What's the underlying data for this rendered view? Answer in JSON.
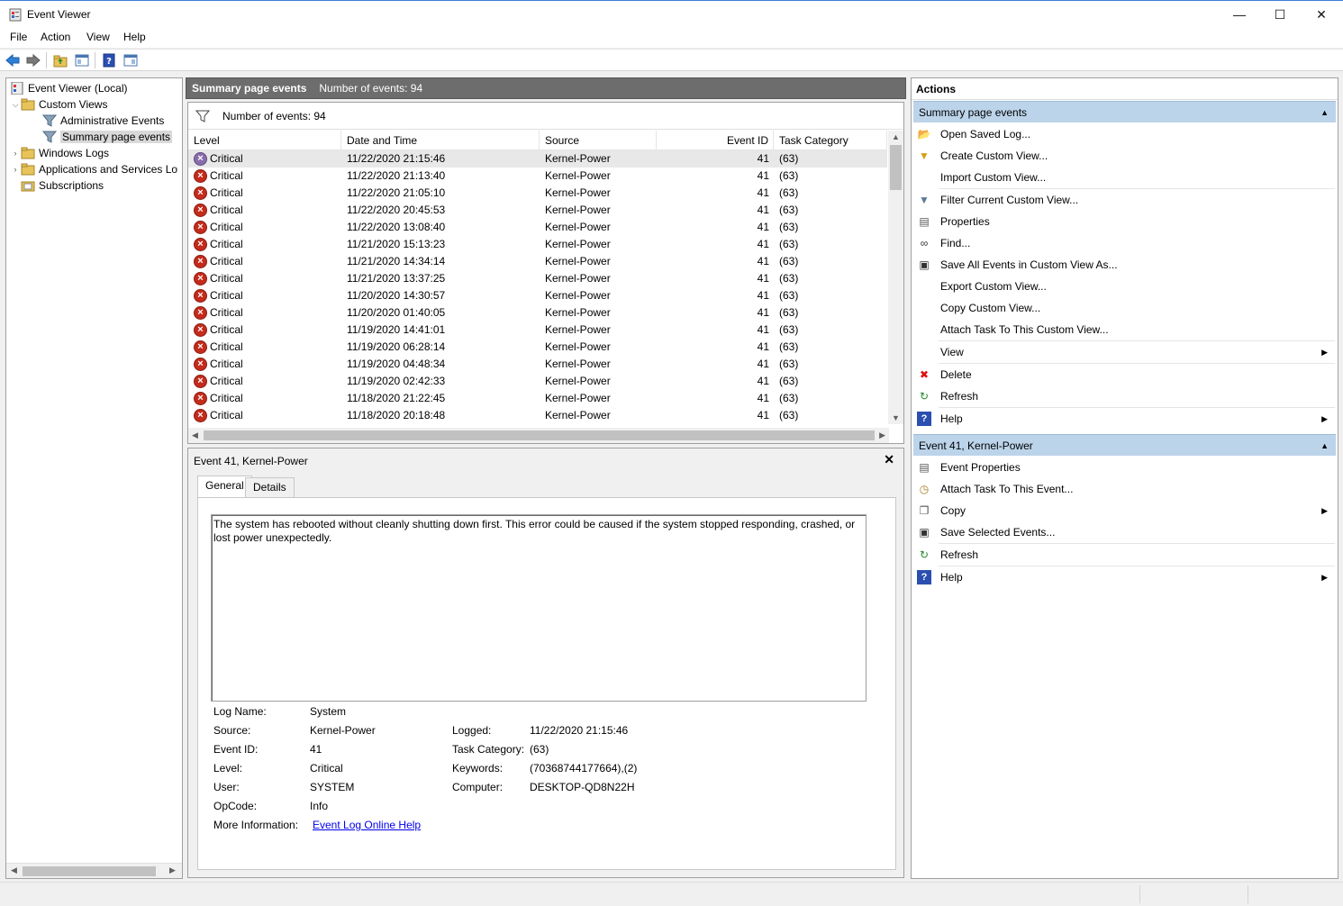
{
  "window": {
    "title": "Event Viewer",
    "minimize": "—",
    "maximize": "☐",
    "close": "✕"
  },
  "menu": [
    "File",
    "Action",
    "View",
    "Help"
  ],
  "tree": {
    "root": "Event Viewer (Local)",
    "custom_views": "Custom Views",
    "admin_events": "Administrative Events",
    "summary_events": "Summary page events",
    "windows_logs": "Windows Logs",
    "apps_services": "Applications and Services Lo",
    "subscriptions": "Subscriptions"
  },
  "center": {
    "header_title": "Summary page events",
    "header_count": "Number of events: 94",
    "filter_count": "Number of events: 94",
    "columns": [
      "Level",
      "Date and Time",
      "Source",
      "Event ID",
      "Task Category"
    ],
    "rows": [
      {
        "level": "Critical",
        "datetime": "11/22/2020 21:15:46",
        "source": "Kernel-Power",
        "id": "41",
        "task": "(63)"
      },
      {
        "level": "Critical",
        "datetime": "11/22/2020 21:13:40",
        "source": "Kernel-Power",
        "id": "41",
        "task": "(63)"
      },
      {
        "level": "Critical",
        "datetime": "11/22/2020 21:05:10",
        "source": "Kernel-Power",
        "id": "41",
        "task": "(63)"
      },
      {
        "level": "Critical",
        "datetime": "11/22/2020 20:45:53",
        "source": "Kernel-Power",
        "id": "41",
        "task": "(63)"
      },
      {
        "level": "Critical",
        "datetime": "11/22/2020 13:08:40",
        "source": "Kernel-Power",
        "id": "41",
        "task": "(63)"
      },
      {
        "level": "Critical",
        "datetime": "11/21/2020 15:13:23",
        "source": "Kernel-Power",
        "id": "41",
        "task": "(63)"
      },
      {
        "level": "Critical",
        "datetime": "11/21/2020 14:34:14",
        "source": "Kernel-Power",
        "id": "41",
        "task": "(63)"
      },
      {
        "level": "Critical",
        "datetime": "11/21/2020 13:37:25",
        "source": "Kernel-Power",
        "id": "41",
        "task": "(63)"
      },
      {
        "level": "Critical",
        "datetime": "11/20/2020 14:30:57",
        "source": "Kernel-Power",
        "id": "41",
        "task": "(63)"
      },
      {
        "level": "Critical",
        "datetime": "11/20/2020 01:40:05",
        "source": "Kernel-Power",
        "id": "41",
        "task": "(63)"
      },
      {
        "level": "Critical",
        "datetime": "11/19/2020 14:41:01",
        "source": "Kernel-Power",
        "id": "41",
        "task": "(63)"
      },
      {
        "level": "Critical",
        "datetime": "11/19/2020 06:28:14",
        "source": "Kernel-Power",
        "id": "41",
        "task": "(63)"
      },
      {
        "level": "Critical",
        "datetime": "11/19/2020 04:48:34",
        "source": "Kernel-Power",
        "id": "41",
        "task": "(63)"
      },
      {
        "level": "Critical",
        "datetime": "11/19/2020 02:42:33",
        "source": "Kernel-Power",
        "id": "41",
        "task": "(63)"
      },
      {
        "level": "Critical",
        "datetime": "11/18/2020 21:22:45",
        "source": "Kernel-Power",
        "id": "41",
        "task": "(63)"
      },
      {
        "level": "Critical",
        "datetime": "11/18/2020 20:18:48",
        "source": "Kernel-Power",
        "id": "41",
        "task": "(63)"
      }
    ]
  },
  "detail": {
    "title": "Event 41, Kernel-Power",
    "tabs": [
      "General",
      "Details"
    ],
    "description": "The system has rebooted without cleanly shutting down first. This error could be caused if the system stopped responding, crashed, or lost power unexpectedly.",
    "labels": {
      "log_name": "Log Name:",
      "source": "Source:",
      "event_id": "Event ID:",
      "level": "Level:",
      "user": "User:",
      "opcode": "OpCode:",
      "more_info": "More Information:",
      "logged": "Logged:",
      "task_category": "Task Category:",
      "keywords": "Keywords:",
      "computer": "Computer:"
    },
    "values": {
      "log_name": "System",
      "source": "Kernel-Power",
      "event_id": "41",
      "level": "Critical",
      "user": "SYSTEM",
      "opcode": "Info",
      "more_info": "Event Log Online Help",
      "logged": "11/22/2020 21:15:46",
      "task_category": "(63)",
      "keywords": "(70368744177664),(2)",
      "computer": "DESKTOP-QD8N22H"
    }
  },
  "actions": {
    "title": "Actions",
    "section1": "Summary page events",
    "items1": [
      {
        "label": "Open Saved Log...",
        "icon": "folder-open-icon"
      },
      {
        "label": "Create Custom View...",
        "icon": "filter-create-icon"
      },
      {
        "label": "Import Custom View...",
        "icon": "none"
      },
      {
        "label": "Filter Current Custom View...",
        "icon": "filter-icon"
      },
      {
        "label": "Properties",
        "icon": "properties-icon"
      },
      {
        "label": "Find...",
        "icon": "binoculars-icon"
      },
      {
        "label": "Save All Events in Custom View As...",
        "icon": "save-icon"
      },
      {
        "label": "Export Custom View...",
        "icon": "none"
      },
      {
        "label": "Copy Custom View...",
        "icon": "none"
      },
      {
        "label": "Attach Task To This Custom View...",
        "icon": "none"
      },
      {
        "label": "View",
        "icon": "none"
      },
      {
        "label": "Delete",
        "icon": "delete-icon"
      },
      {
        "label": "Refresh",
        "icon": "refresh-icon"
      },
      {
        "label": "Help",
        "icon": "help-icon"
      }
    ],
    "section2": "Event 41, Kernel-Power",
    "items2": [
      {
        "label": "Event Properties",
        "icon": "properties-icon"
      },
      {
        "label": "Attach Task To This Event...",
        "icon": "task-icon"
      },
      {
        "label": "Copy",
        "icon": "copy-icon"
      },
      {
        "label": "Save Selected Events...",
        "icon": "save-icon"
      },
      {
        "label": "Refresh",
        "icon": "refresh-icon"
      },
      {
        "label": "Help",
        "icon": "help-icon"
      }
    ]
  },
  "colors": {
    "critical": "#c42b1c",
    "section_header": "#bcd4ea",
    "pane_header": "#6d6d6d"
  }
}
